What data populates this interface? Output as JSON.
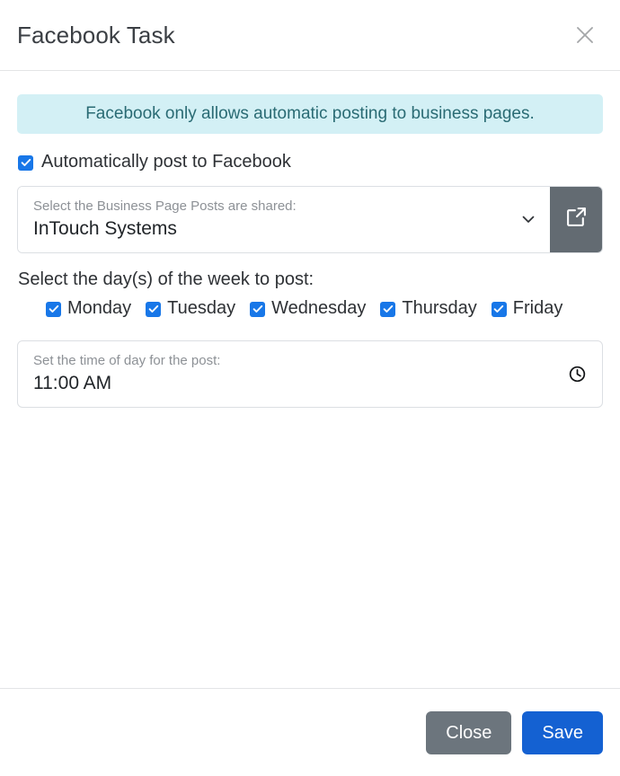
{
  "header": {
    "title": "Facebook Task",
    "close_icon": "close-icon"
  },
  "alert": {
    "text": "Facebook only allows automatic posting to business pages.",
    "bg_color": "#d3f0f5",
    "text_color": "#2a6b74"
  },
  "auto_post": {
    "label": "Automatically post to Facebook",
    "checked": true
  },
  "business_page": {
    "label": "Select the Business Page Posts are shared:",
    "value": "InTouch Systems",
    "chevron_icon": "chevron-down-icon",
    "external_link_icon": "external-link-icon"
  },
  "days": {
    "title": "Select the day(s) of the week to post:",
    "items": [
      {
        "label": "Monday",
        "checked": true
      },
      {
        "label": "Tuesday",
        "checked": true
      },
      {
        "label": "Wednesday",
        "checked": true
      },
      {
        "label": "Thursday",
        "checked": true
      },
      {
        "label": "Friday",
        "checked": true
      }
    ]
  },
  "time": {
    "label": "Set the time of day for the post:",
    "value": "11:00 AM",
    "clock_icon": "clock-icon"
  },
  "footer": {
    "close_label": "Close",
    "save_label": "Save",
    "close_color": "#6c757d",
    "save_color": "#1461d2"
  }
}
